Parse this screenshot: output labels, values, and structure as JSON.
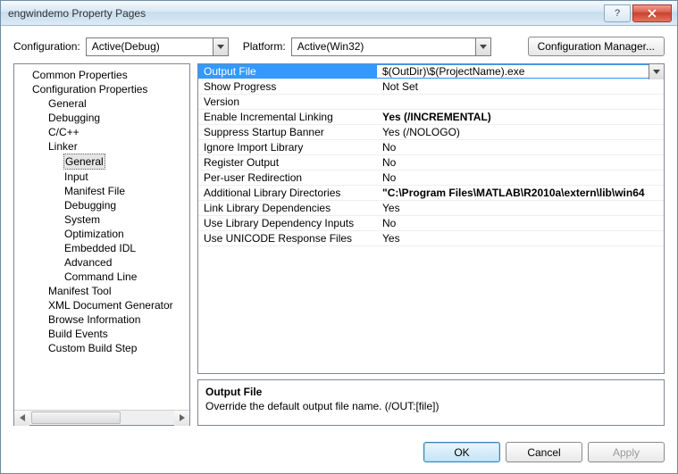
{
  "window": {
    "title": "engwindemo Property Pages"
  },
  "config": {
    "label": "Configuration:",
    "value": "Active(Debug)",
    "platform_label": "Platform:",
    "platform_value": "Active(Win32)",
    "manager_btn": "Configuration Manager..."
  },
  "tree": {
    "items": [
      {
        "label": "Common Properties",
        "level": 0
      },
      {
        "label": "Configuration Properties",
        "level": 0
      },
      {
        "label": "General",
        "level": 1
      },
      {
        "label": "Debugging",
        "level": 1
      },
      {
        "label": "C/C++",
        "level": 1
      },
      {
        "label": "Linker",
        "level": 1
      },
      {
        "label": "General",
        "level": 2,
        "selected": true
      },
      {
        "label": "Input",
        "level": 2
      },
      {
        "label": "Manifest File",
        "level": 2
      },
      {
        "label": "Debugging",
        "level": 2
      },
      {
        "label": "System",
        "level": 2
      },
      {
        "label": "Optimization",
        "level": 2
      },
      {
        "label": "Embedded IDL",
        "level": 2
      },
      {
        "label": "Advanced",
        "level": 2
      },
      {
        "label": "Command Line",
        "level": 2
      },
      {
        "label": "Manifest Tool",
        "level": 1
      },
      {
        "label": "XML Document Generator",
        "level": 1
      },
      {
        "label": "Browse Information",
        "level": 1
      },
      {
        "label": "Build Events",
        "level": 1
      },
      {
        "label": "Custom Build Step",
        "level": 1
      }
    ]
  },
  "props": {
    "rows": [
      {
        "name": "Output File",
        "value": "$(OutDir)\\$(ProjectName).exe",
        "selected": true
      },
      {
        "name": "Show Progress",
        "value": "Not Set"
      },
      {
        "name": "Version",
        "value": ""
      },
      {
        "name": "Enable Incremental Linking",
        "value": "Yes (/INCREMENTAL)",
        "bold": true
      },
      {
        "name": "Suppress Startup Banner",
        "value": "Yes (/NOLOGO)"
      },
      {
        "name": "Ignore Import Library",
        "value": "No"
      },
      {
        "name": "Register Output",
        "value": "No"
      },
      {
        "name": "Per-user Redirection",
        "value": "No"
      },
      {
        "name": "Additional Library Directories",
        "value": "\"C:\\Program Files\\MATLAB\\R2010a\\extern\\lib\\win64",
        "bold": true
      },
      {
        "name": "Link Library Dependencies",
        "value": "Yes"
      },
      {
        "name": "Use Library Dependency Inputs",
        "value": "No"
      },
      {
        "name": "Use UNICODE Response Files",
        "value": "Yes"
      }
    ]
  },
  "desc": {
    "title": "Output File",
    "text": "Override the default output file name.     (/OUT:[file])"
  },
  "footer": {
    "ok": "OK",
    "cancel": "Cancel",
    "apply": "Apply"
  }
}
